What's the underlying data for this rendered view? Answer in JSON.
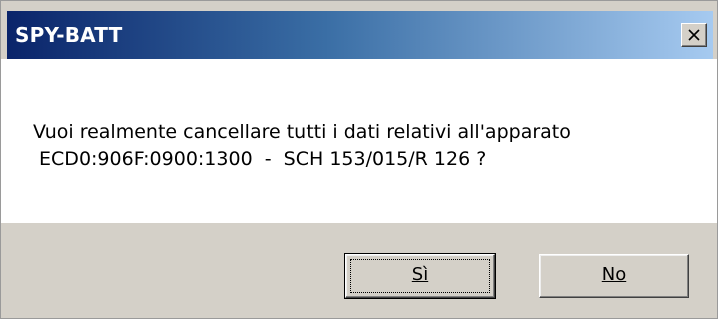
{
  "dialog": {
    "title": "SPY-BATT",
    "close_icon": "close-icon",
    "message_line1": "Vuoi realmente cancellare tutti i dati relativi all'apparato",
    "message_line2": " ECD0:906F:0900:1300  -  SCH 153/015/R 126 ?",
    "buttons": {
      "yes_label": "Sì",
      "no_label": "No"
    }
  },
  "colors": {
    "title_gradient_start": "#0a246a",
    "title_gradient_end": "#a6caf0",
    "face": "#d4d0c8"
  }
}
